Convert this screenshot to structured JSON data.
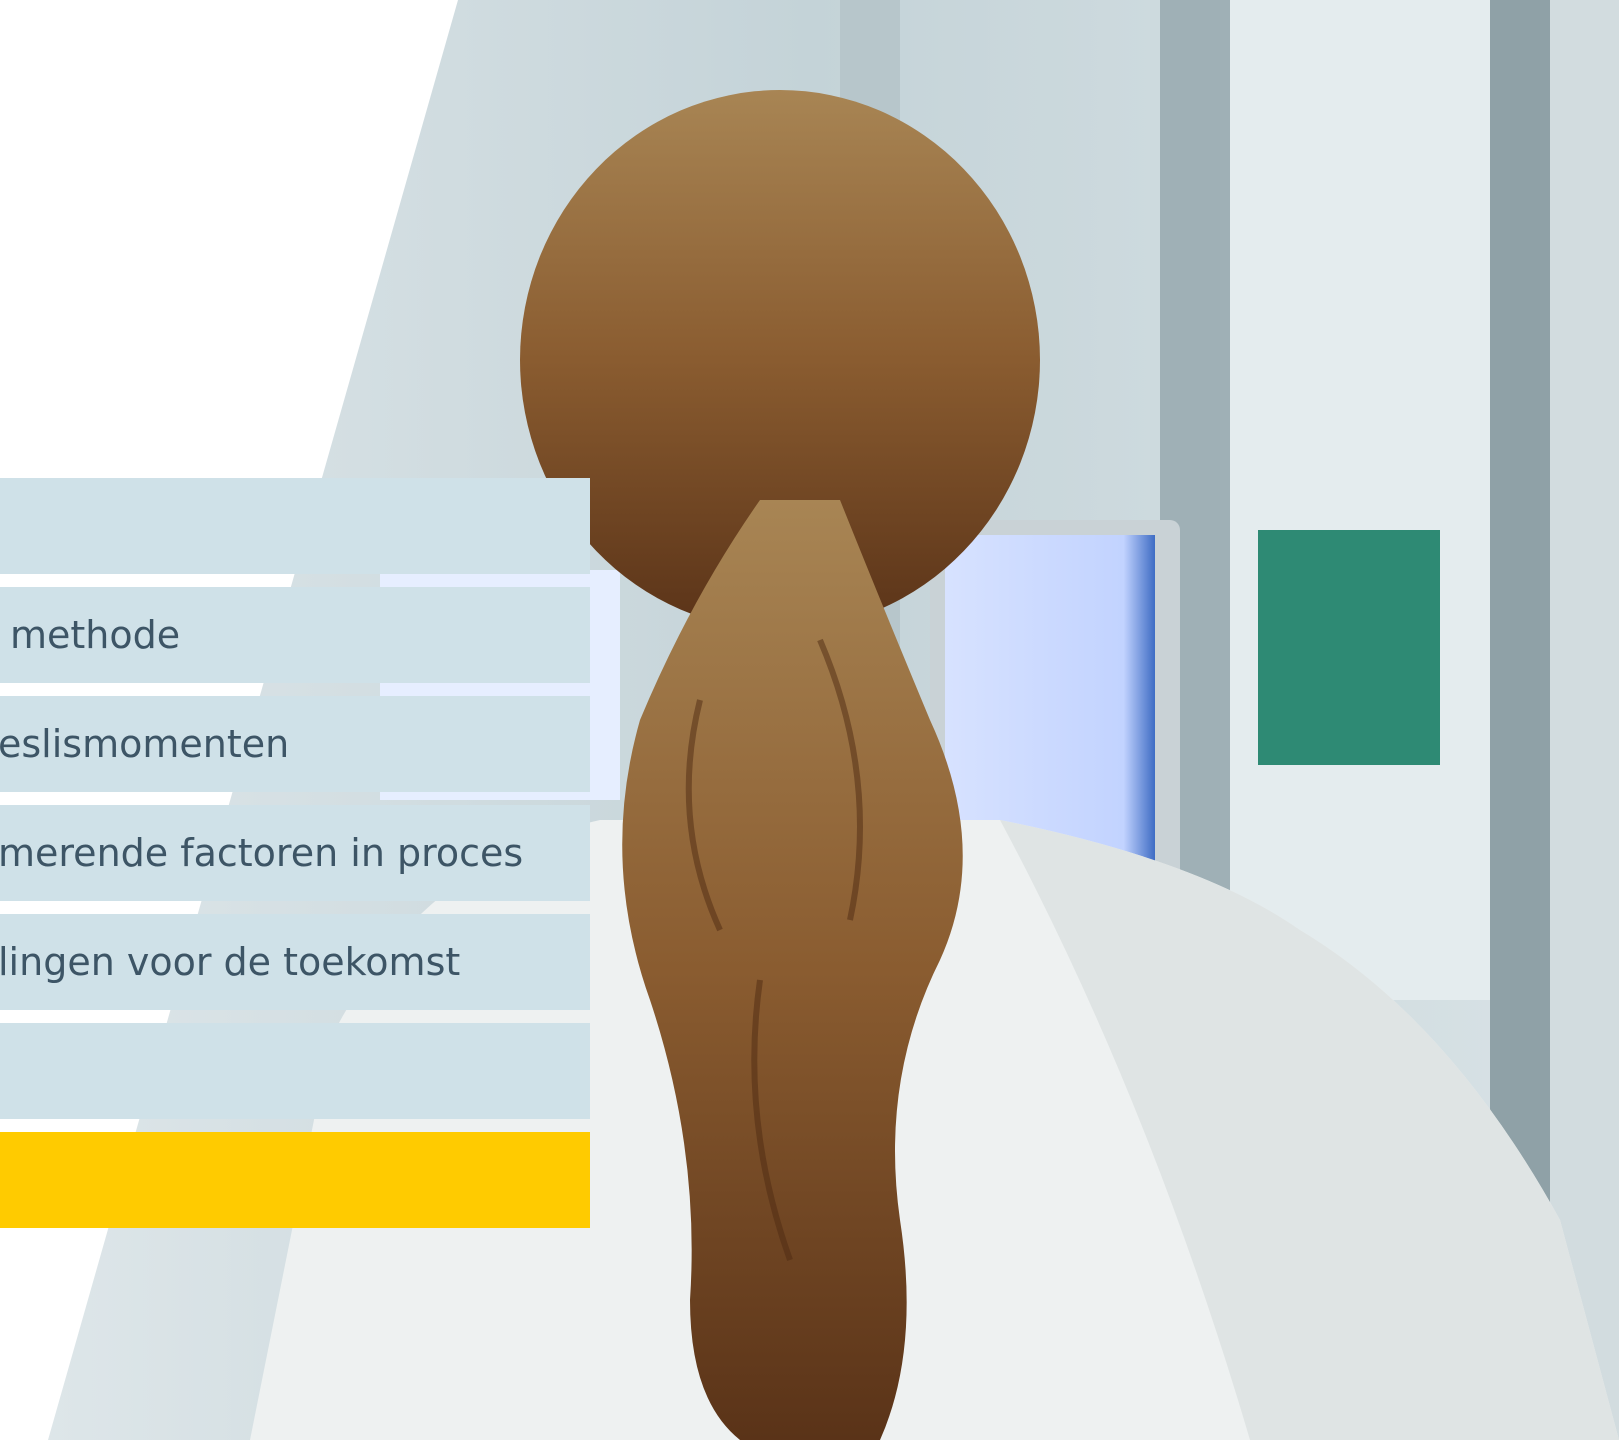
{
  "colors": {
    "bar_background": "#cfe1e8",
    "bar_text": "#3d5566",
    "accent_bar": "#ffcb00",
    "panel": "#ffffff"
  },
  "menu": {
    "items": [
      {
        "label": ""
      },
      {
        "label": "methode"
      },
      {
        "label": "eslismomenten"
      },
      {
        "label": "merende factoren in proces"
      },
      {
        "label": "lingen voor de toekomst"
      },
      {
        "label": ""
      },
      {
        "label": "",
        "accent": true
      }
    ]
  },
  "photo": {
    "subject": "person-with-ponytail-at-monitor"
  }
}
